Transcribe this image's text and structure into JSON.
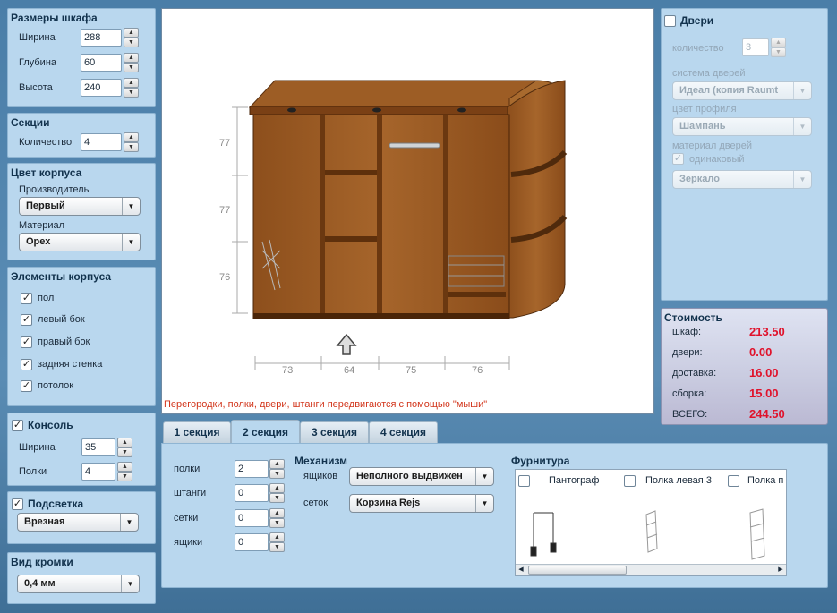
{
  "dimensions": {
    "title": "Размеры шкафа",
    "width_label": "Ширина",
    "width_value": "288",
    "depth_label": "Глубина",
    "depth_value": "60",
    "height_label": "Высота",
    "height_value": "240"
  },
  "sections": {
    "title": "Секции",
    "count_label": "Количество",
    "count_value": "4"
  },
  "body_color": {
    "title": "Цвет корпуса",
    "maker_label": "Производитель",
    "maker_value": "Первый",
    "material_label": "Материал",
    "material_value": "Орех"
  },
  "body_elements": {
    "title": "Элементы корпуса",
    "items": [
      {
        "label": "пол",
        "checked": "✓"
      },
      {
        "label": "левый бок",
        "checked": "✓"
      },
      {
        "label": "правый бок",
        "checked": "✓"
      },
      {
        "label": "задняя стенка",
        "checked": "✓"
      },
      {
        "label": "потолок",
        "checked": "✓"
      }
    ]
  },
  "console": {
    "title": "Консоль",
    "checked": "✓",
    "width_label": "Ширина",
    "width_value": "35",
    "shelves_label": "Полки",
    "shelves_value": "4"
  },
  "lighting": {
    "title": "Подсветка",
    "checked": "✓",
    "value": "Врезная"
  },
  "edge": {
    "title": "Вид кромки",
    "value": "0,4 мм"
  },
  "preview": {
    "dims_left": [
      "77",
      "77",
      "76"
    ],
    "dims_bottom": [
      "73",
      "64",
      "75",
      "76"
    ],
    "hint": "Перегородки, полки, двери, штанги передвигаются с помощью \"мыши\""
  },
  "doors": {
    "title": "Двери",
    "checked": "",
    "count_label": "количество",
    "count_value": "3",
    "system_label": "система дверей",
    "system_value": "Идеал (копия Raumt",
    "profile_label": "цвет профиля",
    "profile_value": "Шампань",
    "material_label": "материал дверей",
    "same_label": "одинаковый",
    "same_checked": "✓",
    "material_value": "Зеркало"
  },
  "cost": {
    "title": "Стоимость",
    "rows": [
      {
        "label": "шкаф:",
        "value": "213.50"
      },
      {
        "label": "двери:",
        "value": "0.00"
      },
      {
        "label": "доставка:",
        "value": "16.00"
      },
      {
        "label": "сборка:",
        "value": "15.00"
      },
      {
        "label": "ВСЕГО:",
        "value": "244.50"
      }
    ]
  },
  "tabs": [
    "1 секция",
    "2 секция",
    "3 секция",
    "4 секция"
  ],
  "section_tab": {
    "fields": [
      {
        "label": "полки",
        "value": "2"
      },
      {
        "label": "штанги",
        "value": "0"
      },
      {
        "label": "сетки",
        "value": "0"
      },
      {
        "label": "ящики",
        "value": "0"
      }
    ],
    "mechanism_title": "Механизм",
    "drawers_label": "ящиков",
    "drawers_value": "Неполного выдвижен",
    "nets_label": "сеток",
    "nets_value": "Корзина Rejs",
    "hardware_title": "Фурнитура",
    "hardware_items": [
      "Пантограф",
      "Полка левая 3",
      "Полка п"
    ]
  },
  "colors": {
    "accent_red": "#e0122b",
    "panel": "#b9d7ee",
    "wood": "#9a5a22"
  }
}
